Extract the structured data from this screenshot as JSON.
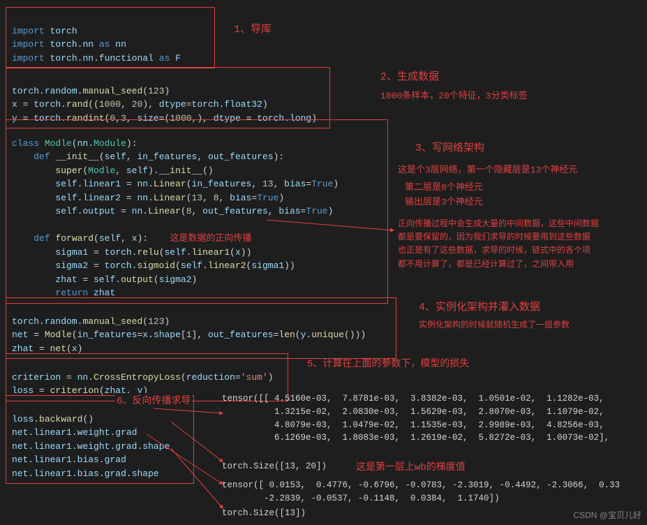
{
  "box1": {
    "l1": "import torch",
    "l2": "import torch.nn as nn",
    "l3": "import torch.nn.functional as F"
  },
  "annot1": "1、导库",
  "box2": {
    "l1": "torch.random.manual_seed(123)",
    "l2": "x = torch.rand((1000, 20), dtype=torch.float32)",
    "l3": "y = torch.randint(0,3, size=(1000,), dtype = torch.long)"
  },
  "annot2a": "2、生成数据",
  "annot2b": "1000条样本，20个特征，3分类标签",
  "box3": {
    "l1": "class Modle(nn.Module):",
    "l2": "    def __init__(self, in_features, out_features):",
    "l3": "        super(Modle, self).__init__()",
    "l4": "        self.linear1 = nn.Linear(in_features, 13, bias=True)",
    "l5": "        self.linear2 = nn.Linear(13, 8, bias=True)",
    "l6": "        self.output = nn.Linear(8, out_features, bias=True)",
    "l7": "",
    "l8a": "    def forward(self, x):",
    "l8b": "这是数据的正向传播",
    "l9": "        sigma1 = torch.relu(self.linear1(x))",
    "l10": "        sigma2 = torch.sigmoid(self.linear2(sigma1))",
    "l11": "        zhat = self.output(sigma2)",
    "l12": "        return zhat"
  },
  "annot3a": "3、写网络架构",
  "annot3b": "这是个3层网络，第一个隐藏层是13个神经元",
  "annot3c": "第二层是8个神经元",
  "annot3d": "输出层是3个神经元",
  "annot3e": "正向传播过程中会生成大量的中间数据，这些中间数据\n都是要保留的，因为我们求导的时候要用到这些数据\n也正是有了这些数据，求导的时候，链式中的各个项\n都不用计算了，都是已经计算过了，之间带入用",
  "box4": {
    "l1": "torch.random.manual_seed(123)",
    "l2": "net = Modle(in_features=x.shape[1], out_features=len(y.unique()))",
    "l3": "zhat = net(x)"
  },
  "annot4a": "4、实例化架构并灌入数据",
  "annot4b": "实例化架构的时候就随机生成了一组参数",
  "box5": {
    "l1": "criterion = nn.CrossEntropyLoss(reduction='sum')",
    "l2": "loss = criterion(zhat, y)"
  },
  "annot5": "5、计算在上面的参数下，模型的损失",
  "box6": {
    "l1": "loss.backward()",
    "l2": "net.linear1.weight.grad",
    "l3": "net.linear1.weight.grad.shape",
    "l4": "net.linear1.bias.grad",
    "l5": "net.linear1.bias.grad.shape"
  },
  "annot6": "6、反向传播求导",
  "out1": "tensor([[ 4.5160e-03,  7.8781e-03,  3.8382e-03,  1.0501e-02,  1.1282e-03,\n          1.3215e-02,  2.0830e-03,  1.5629e-03,  2.8070e-03,  1.1079e-02,\n          4.8079e-03,  1.0479e-02,  1.1535e-03,  2.9989e-03,  4.8256e-03,\n          6.1269e-03,  1.8083e-03,  1.2619e-02,  5.8272e-03,  1.0073e-02],",
  "out2": "torch.Size([13, 20])",
  "annot7": "这是第一层上wb的梯度值",
  "out3": "tensor([ 0.0153,  0.4776, -0.6796, -0.0783, -2.3019, -0.4492, -2.3066,  0.33\n        -2.2839, -0.0537, -0.1148,  0.0384,  1.1740])",
  "out4": "torch.Size([13])",
  "watermark": "CSDN @宝贝儿好"
}
